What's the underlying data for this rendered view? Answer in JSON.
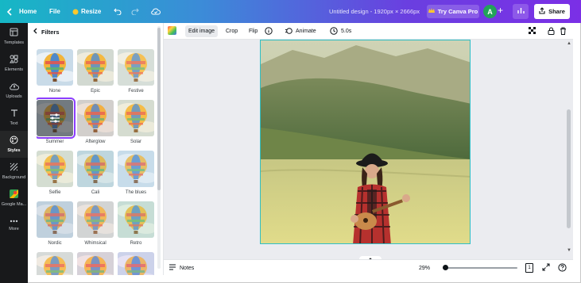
{
  "topbar": {
    "home_label": "Home",
    "file_label": "File",
    "resize_label": "Resize",
    "title": "Untitled design - 1920px × 2666px",
    "try_pro_label": "Try Canva Pro",
    "avatar_letter": "A",
    "share_label": "Share"
  },
  "rail": {
    "items": [
      {
        "label": "Templates",
        "icon": "templates-icon"
      },
      {
        "label": "Elements",
        "icon": "elements-icon"
      },
      {
        "label": "Uploads",
        "icon": "uploads-icon"
      },
      {
        "label": "Text",
        "icon": "text-icon"
      },
      {
        "label": "Styles",
        "icon": "styles-icon"
      },
      {
        "label": "Background",
        "icon": "background-icon"
      },
      {
        "label": "Google Ma...",
        "icon": "google-maps-icon"
      },
      {
        "label": "More",
        "icon": "more-icon"
      }
    ]
  },
  "panel": {
    "title": "Filters",
    "filters": [
      {
        "label": "None"
      },
      {
        "label": "Epic"
      },
      {
        "label": "Festive"
      },
      {
        "label": "Summer"
      },
      {
        "label": "Afterglow"
      },
      {
        "label": "Solar"
      },
      {
        "label": "Selfie"
      },
      {
        "label": "Cali"
      },
      {
        "label": "The blues"
      },
      {
        "label": "Nordic"
      },
      {
        "label": "Whimsical"
      },
      {
        "label": "Retro"
      },
      {
        "label": ""
      },
      {
        "label": ""
      },
      {
        "label": ""
      }
    ]
  },
  "toolbar": {
    "edit_image_label": "Edit image",
    "crop_label": "Crop",
    "flip_label": "Flip",
    "animate_label": "Animate",
    "duration_label": "5.0s"
  },
  "bottombar": {
    "notes_label": "Notes",
    "zoom_label": "29%",
    "page_label": "1"
  },
  "colors": {
    "accent": "#8b3dff",
    "rail_bg": "#18191b",
    "canvas_bg": "#ebecf0",
    "selection": "#2fbfc6"
  }
}
